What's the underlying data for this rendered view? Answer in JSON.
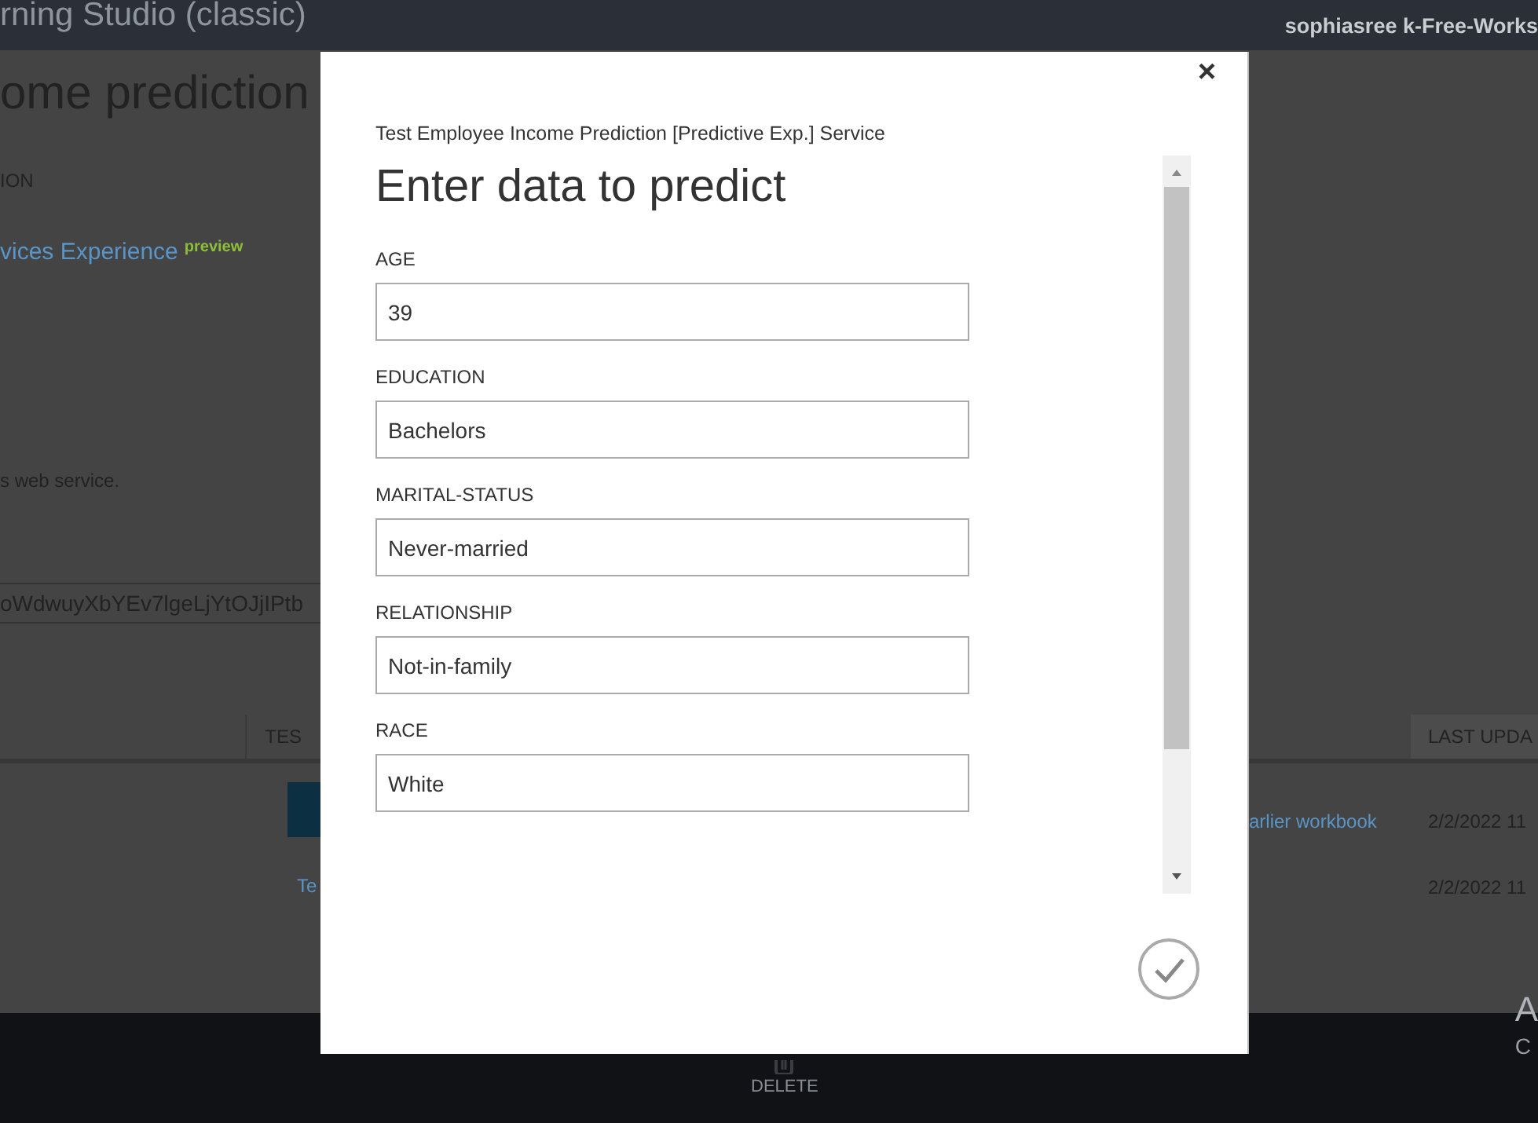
{
  "header": {
    "app_title": "rning Studio (classic)",
    "account": "sophiasree k-Free-Works"
  },
  "page": {
    "title": "ome prediction",
    "section_label": "ION",
    "link": "vices Experience",
    "link_badge": "preview",
    "note": "s web service.",
    "api_key": "oWdwuyXbYEv7lgeLjYtOJjIPtb",
    "table": {
      "columns": [
        "TES",
        "LAST UPDA"
      ],
      "rows": [
        {
          "description": "arlier workbook",
          "updated": "2/2/2022 11"
        },
        {
          "name": "Te",
          "updated": "2/2/2022 11"
        }
      ]
    }
  },
  "footer": {
    "delete_label": "DELETE",
    "column_1": "A",
    "column_2": "C"
  },
  "dialog": {
    "service": "Test Employee Income Prediction [Predictive Exp.] Service",
    "title": "Enter data to predict",
    "close": "×",
    "fields": [
      {
        "label": "AGE",
        "value": "39"
      },
      {
        "label": "EDUCATION",
        "value": "Bachelors"
      },
      {
        "label": "MARITAL-STATUS",
        "value": "Never-married"
      },
      {
        "label": "RELATIONSHIP",
        "value": "Not-in-family"
      },
      {
        "label": "RACE",
        "value": "White"
      }
    ]
  }
}
